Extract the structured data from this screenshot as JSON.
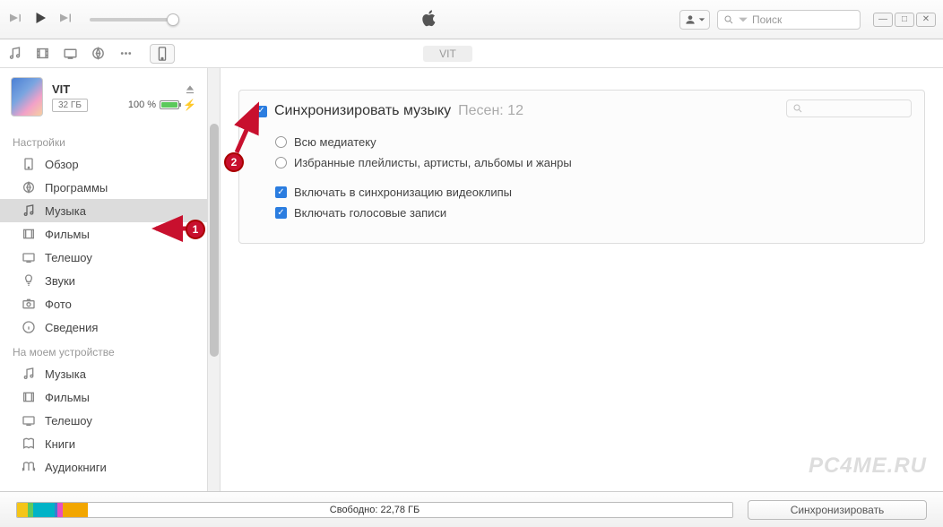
{
  "search_placeholder": "Поиск",
  "device_pill": "VIT",
  "device": {
    "name": "VIT",
    "storage": "32 ГБ",
    "battery_pct": "100 %"
  },
  "sidebar": {
    "settings_heading": "Настройки",
    "settings": [
      "Обзор",
      "Программы",
      "Музыка",
      "Фильмы",
      "Телешоу",
      "Звуки",
      "Фото",
      "Сведения"
    ],
    "ondevice_heading": "На моем устройстве",
    "ondevice": [
      "Музыка",
      "Фильмы",
      "Телешоу",
      "Книги",
      "Аудиокниги"
    ]
  },
  "sync": {
    "title": "Синхронизировать музыку",
    "count_label": "Песен: 12",
    "radio1": "Всю медиатеку",
    "radio2": "Избранные плейлисты, артисты, альбомы и жанры",
    "cb1": "Включать в синхронизацию видеоклипы",
    "cb2": "Включать голосовые записи"
  },
  "bottom": {
    "free_label": "Свободно: 22,78 ГБ",
    "sync_btn": "Синхронизировать"
  },
  "watermark": "PC4ME.RU",
  "annotations": {
    "b1": "1",
    "b2": "2"
  }
}
